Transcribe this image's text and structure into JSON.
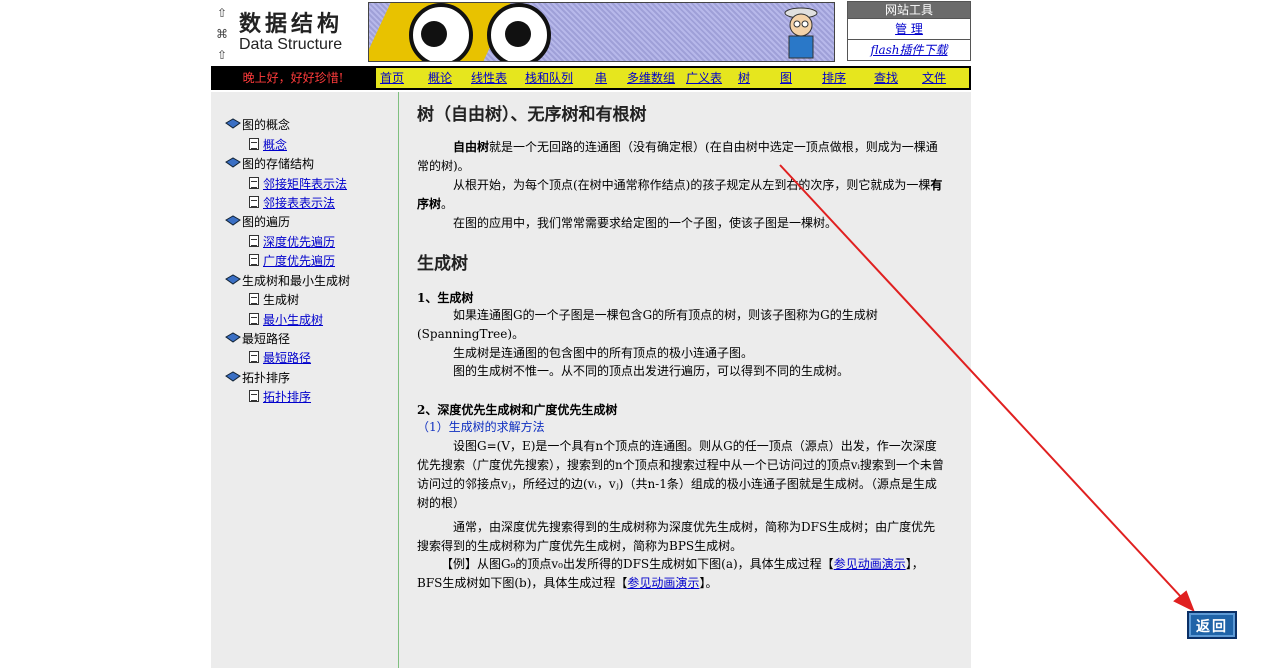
{
  "logo": {
    "side_glyphs": [
      "⇧",
      "⌘",
      "⇧"
    ],
    "title_cn": "数据结构",
    "title_en": "Data Structure"
  },
  "tools": {
    "header": "网站工具",
    "manage_label": "管 理",
    "flash_label": "flash插件下载"
  },
  "nav": {
    "greeting": "晚上好，好好珍惜!",
    "items": [
      "首页",
      "概论",
      "线性表",
      "栈和队列",
      "串",
      "多维数组",
      "广义表",
      "树",
      "图",
      "排序",
      "查找",
      "文件"
    ]
  },
  "sidebar": {
    "groups": [
      {
        "title": "图的概念",
        "items": [
          {
            "label": "概念",
            "link": true
          }
        ]
      },
      {
        "title": "图的存储结构",
        "items": [
          {
            "label": "邻接矩阵表示法",
            "link": true
          },
          {
            "label": "邻接表表示法",
            "link": true
          }
        ]
      },
      {
        "title": "图的遍历",
        "items": [
          {
            "label": "深度优先遍历",
            "link": true
          },
          {
            "label": "广度优先遍历",
            "link": true
          }
        ]
      },
      {
        "title": "生成树和最小生成树",
        "items": [
          {
            "label": "生成树",
            "link": false
          },
          {
            "label": "最小生成树",
            "link": true
          }
        ]
      },
      {
        "title": "最短路径",
        "items": [
          {
            "label": "最短路径",
            "link": true
          }
        ]
      },
      {
        "title": "拓扑排序",
        "items": [
          {
            "label": "拓扑排序",
            "link": true
          }
        ]
      }
    ]
  },
  "content": {
    "heading1": "树（自由树）、无序树和有根树",
    "p1_bold": "自由树",
    "p1_rest": "就是一个无回路的连通图（没有确定根）(在自由树中选定一顶点做根，则成为一棵通常的树)。",
    "p2_start": "从根开始，为每个顶点(在树中通常称作结点)的孩子规定从左到右的次序，则它就成为一棵",
    "p2_bold": "有序树",
    "p2_end": "。",
    "p3": "在图的应用中，我们常常需要求给定图的一个子图，使该子图是一棵树。",
    "heading2": "生成树",
    "s1_title": "1、生成树",
    "s1_p1": "如果连通图G的一个子图是一棵包含G的所有顶点的树，则该子图称为G的生成树(SpanningTree)。",
    "s1_p2": "生成树是连通图的包含图中的所有顶点的极小连通子图。",
    "s1_p3": "图的生成树不惟一。从不同的顶点出发进行遍历，可以得到不同的生成树。",
    "s2_title": "2、深度优先生成树和广度优先生成树",
    "s2_sub": "（1）生成树的求解方法",
    "s2_p1": "设图G=(V，E)是一个具有n个顶点的连通图。则从G的任一顶点（源点）出发，作一次深度优先搜索（广度优先搜索），搜索到的n个顶点和搜索过程中从一个已访问过的顶点vᵢ搜索到一个未曾访问过的邻接点vⱼ，所经过的边(vᵢ，vⱼ)（共n-1条）组成的极小连通子图就是生成树。（源点是生成树的根）",
    "s2_p2": "通常，由深度优先搜索得到的生成树称为深度优先生成树，简称为DFS生成树；由广度优先搜索得到的生成树称为广度优先生成树，简称为BPS生成树。",
    "ex_a": "【例】从图G₉的顶点v₀出发所得的DFS生成树如下图(a)，具体生成过程【",
    "ex_link1": "参见动画演示",
    "ex_b": "】，BFS生成树如下图(b)，具体生成过程【",
    "ex_link2": "参见动画演示",
    "ex_c": "】。"
  },
  "back_button": "返回",
  "colors": {
    "arrow": "#e02020",
    "menu_bg": "#e6e61e",
    "panel_bg": "#ececec",
    "greeting": "#ff3b3b"
  }
}
